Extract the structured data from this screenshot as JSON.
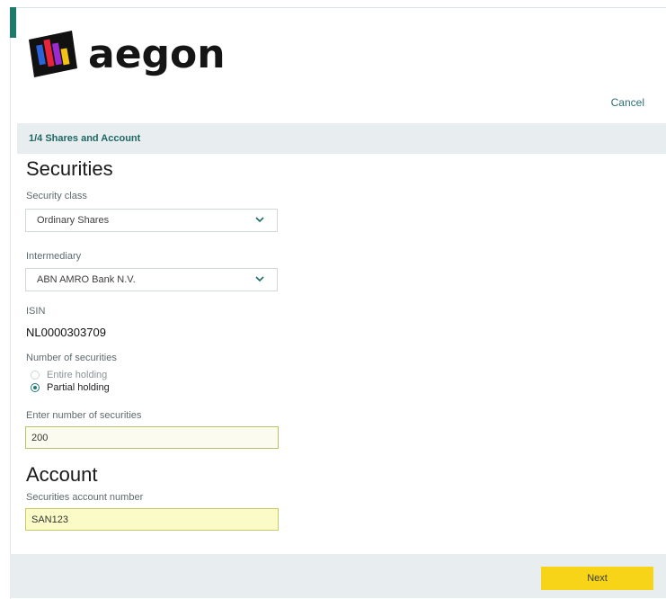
{
  "brand": {
    "name": "aegon"
  },
  "header": {
    "cancel_label": "Cancel"
  },
  "step": {
    "label": "1/4 Shares and Account"
  },
  "securities": {
    "title": "Securities",
    "security_class": {
      "label": "Security class",
      "value": "Ordinary Shares"
    },
    "intermediary": {
      "label": "Intermediary",
      "value": "ABN AMRO Bank N.V."
    },
    "isin": {
      "label": "ISIN",
      "value": "NL0000303709"
    },
    "number": {
      "label": "Number of securities",
      "options": [
        {
          "label": "Entire holding",
          "selected": false
        },
        {
          "label": "Partial holding",
          "selected": true
        }
      ]
    },
    "enter_number": {
      "label": "Enter number of securities",
      "value": "200"
    }
  },
  "account": {
    "title": "Account",
    "account_number": {
      "label": "Securities account number",
      "value": "SAN123"
    }
  },
  "footer": {
    "next_label": "Next"
  },
  "colors": {
    "accent": "#1b7a68",
    "next_button": "#f7d417",
    "link": "#2c6e75"
  }
}
